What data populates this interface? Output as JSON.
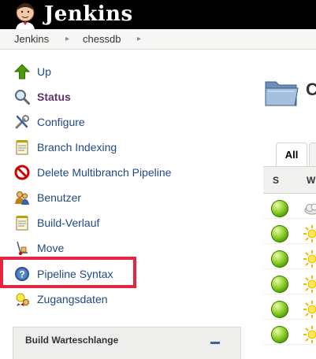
{
  "header": {
    "brand": "Jenkins",
    "logo_icon": "jenkins-butler-icon"
  },
  "breadcrumb": {
    "items": [
      "Jenkins",
      "chessdb"
    ],
    "separator_icon": "chevron-right-icon"
  },
  "tasks": [
    {
      "label": "Up",
      "icon": "up-arrow-icon"
    },
    {
      "label": "Status",
      "icon": "magnifier-icon"
    },
    {
      "label": "Configure",
      "icon": "wrench-screwdriver-icon"
    },
    {
      "label": "Branch Indexing",
      "icon": "notepad-icon"
    },
    {
      "label": "Delete Multibranch Pipeline",
      "icon": "no-entry-icon"
    },
    {
      "label": "Benutzer",
      "icon": "users-icon"
    },
    {
      "label": "Build-Verlauf",
      "icon": "notepad-icon"
    },
    {
      "label": "Move",
      "icon": "hand-truck-icon"
    },
    {
      "label": "Pipeline Syntax",
      "icon": "help-icon"
    },
    {
      "label": "Zugangsdaten",
      "icon": "credentials-icon"
    }
  ],
  "queue": {
    "title": "Build Warteschlange",
    "collapse_icon": "minus-icon"
  },
  "main": {
    "title_fragment": "C",
    "folder_icon": "folder-icon",
    "tabs": [
      "All"
    ],
    "columns": [
      "S",
      "W"
    ],
    "rows": [
      {
        "status": "success",
        "weather": "cloudy"
      },
      {
        "status": "success",
        "weather": "sunny"
      },
      {
        "status": "success",
        "weather": "sunny"
      },
      {
        "status": "success",
        "weather": "sunny"
      },
      {
        "status": "success",
        "weather": "sunny"
      },
      {
        "status": "success",
        "weather": "sunny"
      }
    ]
  },
  "colors": {
    "header_bg": "#000000",
    "link": "#204a87",
    "active_link": "#5c3566",
    "highlight_border": "#e5253f",
    "success": "#4c9a06"
  }
}
